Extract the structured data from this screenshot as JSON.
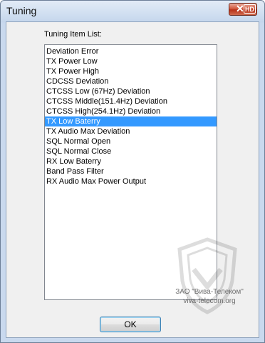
{
  "window": {
    "title": "Tuning",
    "close_label": "✕",
    "close_badge": "HD"
  },
  "list": {
    "label": "Tuning Item List:",
    "selected_index": 7,
    "items": [
      "Deviation Error",
      "TX Power Low",
      "TX Power High",
      "CDCSS Deviation",
      "CTCSS Low (67Hz) Deviation",
      "CTCSS Middle(151.4Hz) Deviation",
      "CTCSS High(254.1Hz) Deviation",
      "TX Low Baterry",
      "TX Audio Max Deviation",
      "SQL Normal Open",
      "SQL Normal Close",
      "RX Low Baterry",
      "Band Pass Filter",
      "RX Audio Max Power Output"
    ]
  },
  "buttons": {
    "ok_label": "OK"
  },
  "watermark": {
    "line1": "ЗАО \"Вива-Телеком\"",
    "line2": "viva-telecom.org"
  },
  "colors": {
    "selection": "#3399ff",
    "close_button": "#c7432a"
  }
}
